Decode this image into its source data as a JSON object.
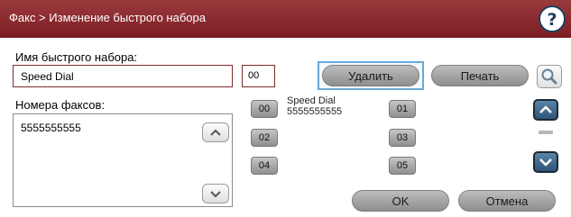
{
  "header": {
    "title": "Факс > Изменение быстрого набора",
    "help_icon": "help-question-icon"
  },
  "form": {
    "name_label": "Имя быстрого набора:",
    "name_value": "Speed Dial",
    "number_value": "00",
    "fax_label": "Номера факсов:",
    "fax_value": "5555555555"
  },
  "actions": {
    "delete_label": "Удалить",
    "print_label": "Печать",
    "ok_label": "OK",
    "cancel_label": "Отмена"
  },
  "speed_dials": [
    {
      "number": "00",
      "name": "Speed Dial",
      "fax": "5555555555"
    },
    {
      "number": "01",
      "name": "",
      "fax": ""
    },
    {
      "number": "02",
      "name": "",
      "fax": ""
    },
    {
      "number": "03",
      "name": "",
      "fax": ""
    },
    {
      "number": "04",
      "name": "",
      "fax": ""
    },
    {
      "number": "05",
      "name": "",
      "fax": ""
    }
  ],
  "colors": {
    "header": "#7c1d23",
    "focus_border": "#6aa9d6",
    "nav_button": "#2e5577"
  }
}
